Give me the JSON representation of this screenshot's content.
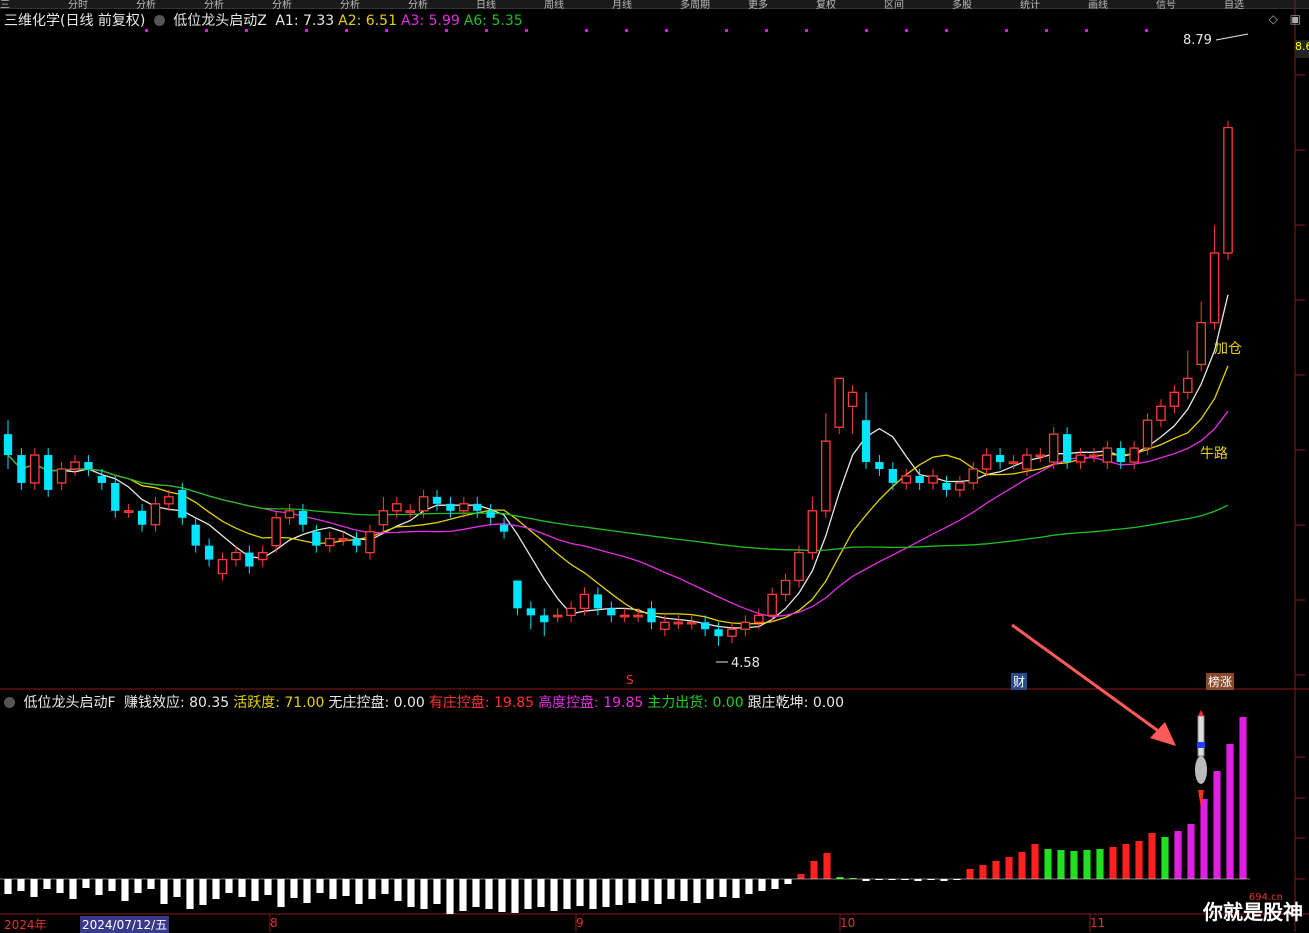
{
  "top_menu": [
    "三",
    "分时",
    "分析",
    "分析",
    "分析",
    "分析",
    "分析",
    "日线",
    "周线",
    "月线",
    "多周期",
    "更多",
    "复权",
    "区间",
    "多股",
    "统计",
    "画线",
    "信号",
    "自选"
  ],
  "main_panel": {
    "stock_name": "三维化学(日线 前复权)",
    "indicator_name": "低位龙头启动Z",
    "indicators": [
      {
        "label": "A1: 7.33",
        "color": "#e8e8e8"
      },
      {
        "label": "A2: 6.51",
        "color": "#e6d200"
      },
      {
        "label": "A3: 5.99",
        "color": "#e22fe2"
      },
      {
        "label": "A6: 5.35",
        "color": "#20c020"
      }
    ],
    "high_price": "8.79",
    "low_price": "4.58",
    "signal_add": "加仓",
    "signal_bull": "牛路",
    "marker_s": "S",
    "marker_cai": "财",
    "marker_bangzhang": "榜涨",
    "right_tag": "8.6"
  },
  "sub_panel": {
    "indicator_name": "低位龙头启动F",
    "fields": [
      {
        "label": "赚钱效应: 80.35",
        "color": "#e8e8e8"
      },
      {
        "label": "活跃度: 71.00",
        "color": "#e6d200"
      },
      {
        "label": "无庄控盘: 0.00",
        "color": "#e8e8e8"
      },
      {
        "label": "有庄控盘: 19.85",
        "color": "#ff3030"
      },
      {
        "label": "高度控盘: 19.85",
        "color": "#e22fe2"
      },
      {
        "label": "主力出货: 0.00",
        "color": "#20d020"
      },
      {
        "label": "跟庄乾坤: 0.00",
        "color": "#e8e8e8"
      }
    ]
  },
  "date_axis": {
    "year_label": "2024年",
    "cursor_date": "2024/07/12/五",
    "months": [
      "8",
      "9",
      "10",
      "11"
    ]
  },
  "watermark": {
    "text": "你就是股神",
    "url": "694.cn"
  },
  "colors": {
    "up": "#ff3c3c",
    "down": "#00e5ff",
    "ma1": "#e8e8e8",
    "ma2": "#e6d200",
    "ma3": "#e22fe2",
    "ma4": "#20c020"
  },
  "chart_data": {
    "type": "candlestick",
    "price_range": [
      4.3,
      9.0
    ],
    "candles": [
      [
        6.1,
        5.95,
        6.2,
        5.85
      ],
      [
        5.95,
        5.75,
        6.0,
        5.7
      ],
      [
        5.75,
        5.95,
        6.0,
        5.7
      ],
      [
        5.95,
        5.7,
        6.0,
        5.65
      ],
      [
        5.75,
        5.85,
        5.9,
        5.7
      ],
      [
        5.85,
        5.9,
        5.95,
        5.8
      ],
      [
        5.9,
        5.85,
        5.95,
        5.8
      ],
      [
        5.8,
        5.75,
        5.85,
        5.7
      ],
      [
        5.75,
        5.55,
        5.8,
        5.5
      ],
      [
        5.55,
        5.55,
        5.6,
        5.5
      ],
      [
        5.55,
        5.45,
        5.6,
        5.4
      ],
      [
        5.45,
        5.6,
        5.65,
        5.4
      ],
      [
        5.6,
        5.65,
        5.7,
        5.55
      ],
      [
        5.7,
        5.5,
        5.75,
        5.45
      ],
      [
        5.45,
        5.3,
        5.5,
        5.25
      ],
      [
        5.3,
        5.2,
        5.35,
        5.15
      ],
      [
        5.1,
        5.2,
        5.25,
        5.05
      ],
      [
        5.2,
        5.25,
        5.3,
        5.15
      ],
      [
        5.25,
        5.15,
        5.3,
        5.1
      ],
      [
        5.2,
        5.25,
        5.3,
        5.15
      ],
      [
        5.3,
        5.5,
        5.55,
        5.25
      ],
      [
        5.5,
        5.55,
        5.6,
        5.45
      ],
      [
        5.55,
        5.45,
        5.6,
        5.4
      ],
      [
        5.4,
        5.3,
        5.45,
        5.25
      ],
      [
        5.3,
        5.35,
        5.4,
        5.25
      ],
      [
        5.35,
        5.35,
        5.4,
        5.3
      ],
      [
        5.35,
        5.3,
        5.4,
        5.25
      ],
      [
        5.25,
        5.4,
        5.45,
        5.2
      ],
      [
        5.45,
        5.55,
        5.65,
        5.4
      ],
      [
        5.55,
        5.6,
        5.65,
        5.5
      ],
      [
        5.55,
        5.55,
        5.6,
        5.5
      ],
      [
        5.55,
        5.65,
        5.7,
        5.5
      ],
      [
        5.65,
        5.6,
        5.7,
        5.55
      ],
      [
        5.6,
        5.55,
        5.65,
        5.5
      ],
      [
        5.55,
        5.6,
        5.65,
        5.5
      ],
      [
        5.6,
        5.55,
        5.65,
        5.5
      ],
      [
        5.55,
        5.5,
        5.6,
        5.45
      ],
      [
        5.45,
        5.4,
        5.5,
        5.35
      ],
      [
        5.05,
        4.85,
        5.05,
        4.8
      ],
      [
        4.85,
        4.8,
        4.9,
        4.7
      ],
      [
        4.8,
        4.75,
        4.85,
        4.65
      ],
      [
        4.8,
        4.8,
        4.85,
        4.75
      ],
      [
        4.8,
        4.85,
        4.9,
        4.75
      ],
      [
        4.85,
        4.95,
        5.0,
        4.8
      ],
      [
        4.95,
        4.85,
        5.0,
        4.8
      ],
      [
        4.85,
        4.8,
        4.9,
        4.75
      ],
      [
        4.8,
        4.8,
        4.85,
        4.75
      ],
      [
        4.8,
        4.8,
        4.85,
        4.75
      ],
      [
        4.85,
        4.75,
        4.9,
        4.7
      ],
      [
        4.7,
        4.75,
        4.8,
        4.65
      ],
      [
        4.75,
        4.75,
        4.8,
        4.7
      ],
      [
        4.75,
        4.75,
        4.8,
        4.7
      ],
      [
        4.75,
        4.7,
        4.8,
        4.65
      ],
      [
        4.7,
        4.65,
        4.75,
        4.58
      ],
      [
        4.65,
        4.7,
        4.75,
        4.6
      ],
      [
        4.7,
        4.75,
        4.8,
        4.65
      ],
      [
        4.75,
        4.8,
        4.85,
        4.7
      ],
      [
        4.8,
        4.95,
        5.0,
        4.75
      ],
      [
        4.95,
        5.05,
        5.1,
        4.9
      ],
      [
        5.05,
        5.25,
        5.3,
        5.0
      ],
      [
        5.25,
        5.55,
        5.65,
        5.2
      ],
      [
        5.55,
        6.05,
        6.25,
        5.5
      ],
      [
        6.15,
        6.5,
        6.45,
        6.1
      ],
      [
        6.3,
        6.4,
        6.45,
        6.1
      ],
      [
        6.2,
        5.9,
        6.4,
        5.85
      ],
      [
        5.9,
        5.85,
        5.95,
        5.8
      ],
      [
        5.85,
        5.75,
        5.9,
        5.7
      ],
      [
        5.75,
        5.8,
        5.85,
        5.7
      ],
      [
        5.8,
        5.75,
        5.85,
        5.7
      ],
      [
        5.75,
        5.8,
        5.85,
        5.7
      ],
      [
        5.75,
        5.7,
        5.8,
        5.65
      ],
      [
        5.7,
        5.75,
        5.8,
        5.65
      ],
      [
        5.75,
        5.85,
        5.9,
        5.7
      ],
      [
        5.85,
        5.95,
        6.0,
        5.8
      ],
      [
        5.95,
        5.9,
        6.0,
        5.85
      ],
      [
        5.9,
        5.9,
        5.95,
        5.85
      ],
      [
        5.85,
        5.95,
        6.0,
        5.8
      ],
      [
        5.95,
        5.95,
        6.0,
        5.9
      ],
      [
        5.9,
        6.1,
        6.15,
        5.85
      ],
      [
        6.1,
        5.9,
        6.15,
        5.85
      ],
      [
        5.9,
        5.95,
        6.0,
        5.85
      ],
      [
        5.95,
        5.95,
        6.0,
        5.9
      ],
      [
        5.9,
        6.0,
        6.05,
        5.85
      ],
      [
        6.0,
        5.9,
        6.05,
        5.85
      ],
      [
        5.9,
        6.0,
        6.05,
        5.85
      ],
      [
        6.0,
        6.2,
        6.25,
        5.95
      ],
      [
        6.2,
        6.3,
        6.35,
        6.15
      ],
      [
        6.3,
        6.4,
        6.45,
        6.25
      ],
      [
        6.4,
        6.5,
        6.7,
        6.35
      ],
      [
        6.6,
        6.9,
        7.05,
        6.55
      ],
      [
        6.9,
        7.4,
        7.6,
        6.85
      ],
      [
        7.4,
        8.3,
        8.35,
        7.35
      ]
    ],
    "ma_lines": [
      "A1",
      "A2",
      "A3",
      "A6"
    ],
    "sub_bars": [
      [
        -15,
        "w"
      ],
      [
        -12,
        "w"
      ],
      [
        -18,
        "w"
      ],
      [
        -10,
        "w"
      ],
      [
        -14,
        "w"
      ],
      [
        -20,
        "w"
      ],
      [
        -9,
        "w"
      ],
      [
        -16,
        "w"
      ],
      [
        -12,
        "w"
      ],
      [
        -22,
        "w"
      ],
      [
        -14,
        "w"
      ],
      [
        -10,
        "w"
      ],
      [
        -25,
        "w"
      ],
      [
        -18,
        "w"
      ],
      [
        -30,
        "w"
      ],
      [
        -26,
        "w"
      ],
      [
        -20,
        "w"
      ],
      [
        -14,
        "w"
      ],
      [
        -18,
        "w"
      ],
      [
        -22,
        "w"
      ],
      [
        -16,
        "w"
      ],
      [
        -28,
        "w"
      ],
      [
        -19,
        "w"
      ],
      [
        -24,
        "w"
      ],
      [
        -14,
        "w"
      ],
      [
        -20,
        "w"
      ],
      [
        -17,
        "w"
      ],
      [
        -25,
        "w"
      ],
      [
        -20,
        "w"
      ],
      [
        -15,
        "w"
      ],
      [
        -22,
        "w"
      ],
      [
        -28,
        "w"
      ],
      [
        -30,
        "w"
      ],
      [
        -25,
        "w"
      ],
      [
        -35,
        "w"
      ],
      [
        -32,
        "w"
      ],
      [
        -28,
        "w"
      ],
      [
        -30,
        "w"
      ],
      [
        -33,
        "w"
      ],
      [
        -34,
        "w"
      ],
      [
        -30,
        "w"
      ],
      [
        -28,
        "w"
      ],
      [
        -32,
        "w"
      ],
      [
        -30,
        "w"
      ],
      [
        -27,
        "w"
      ],
      [
        -30,
        "w"
      ],
      [
        -28,
        "w"
      ],
      [
        -26,
        "w"
      ],
      [
        -24,
        "w"
      ],
      [
        -22,
        "w"
      ],
      [
        -25,
        "w"
      ],
      [
        -20,
        "w"
      ],
      [
        -22,
        "w"
      ],
      [
        -24,
        "w"
      ],
      [
        -20,
        "w"
      ],
      [
        -18,
        "w"
      ],
      [
        -19,
        "w"
      ],
      [
        -15,
        "w"
      ],
      [
        -12,
        "w"
      ],
      [
        -10,
        "w"
      ],
      [
        -5,
        "w"
      ],
      [
        5,
        "r"
      ],
      [
        18,
        "r"
      ],
      [
        26,
        "r"
      ],
      [
        2,
        "g"
      ],
      [
        1,
        "g"
      ],
      [
        -2,
        "w"
      ],
      [
        0,
        "w"
      ],
      [
        -1,
        "w"
      ],
      [
        -1,
        "w"
      ],
      [
        -2,
        "w"
      ],
      [
        -1,
        "w"
      ],
      [
        -2,
        "w"
      ],
      [
        -1,
        "w"
      ],
      [
        10,
        "r"
      ],
      [
        14,
        "r"
      ],
      [
        18,
        "r"
      ],
      [
        22,
        "r"
      ],
      [
        27,
        "r"
      ],
      [
        35,
        "r"
      ],
      [
        30,
        "g"
      ],
      [
        29,
        "g"
      ],
      [
        28,
        "g"
      ],
      [
        29,
        "g"
      ],
      [
        30,
        "g"
      ],
      [
        32,
        "r"
      ],
      [
        35,
        "r"
      ],
      [
        38,
        "r"
      ],
      [
        46,
        "r"
      ],
      [
        42,
        "g"
      ],
      [
        48,
        "m"
      ],
      [
        55,
        "m"
      ],
      [
        80,
        "m"
      ],
      [
        108,
        "m"
      ],
      [
        135,
        "m"
      ],
      [
        162,
        "m"
      ]
    ]
  }
}
